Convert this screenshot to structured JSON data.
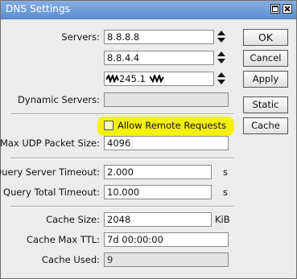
{
  "window": {
    "title": "DNS Settings"
  },
  "servers": {
    "label": "Servers:",
    "entries": [
      "8.8.8.8",
      "8.8.4.4",
      "245.1"
    ]
  },
  "dynamic_servers": {
    "label": "Dynamic Servers:",
    "value": ""
  },
  "allow_remote_requests": {
    "label": "Allow Remote Requests",
    "checked": false,
    "highlight_color": "#f4f20c"
  },
  "max_udp_packet_size": {
    "label": "Max UDP Packet Size:",
    "value": "4096"
  },
  "query_server_timeout": {
    "label": "Query Server Timeout:",
    "value": "2.000",
    "unit": "s"
  },
  "query_total_timeout": {
    "label": "Query Total Timeout:",
    "value": "10.000",
    "unit": "s"
  },
  "cache_size": {
    "label": "Cache Size:",
    "value": "2048",
    "unit": "KiB"
  },
  "cache_max_ttl": {
    "label": "Cache Max TTL:",
    "value": "7d 00:00:00"
  },
  "cache_used": {
    "label": "Cache Used:",
    "value": "9"
  },
  "buttons": {
    "ok": "OK",
    "cancel": "Cancel",
    "apply": "Apply",
    "static": "Static",
    "cache": "Cache"
  },
  "colors": {
    "titlebar": "#5d8fd3",
    "window_bg": "#ececec",
    "highlight": "#f4f20c"
  }
}
